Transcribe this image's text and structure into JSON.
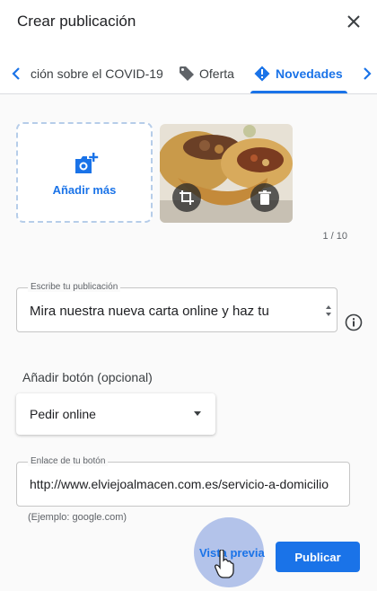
{
  "header": {
    "title": "Crear publicación"
  },
  "tabs": [
    {
      "label": "ción sobre el COVID-19",
      "icon": ""
    },
    {
      "label": "Oferta",
      "icon": "tag-icon"
    },
    {
      "label": "Novedades",
      "icon": "alert-icon",
      "active": true
    }
  ],
  "media": {
    "add_more_label": "Añadir más",
    "counter": "1 / 10"
  },
  "post": {
    "label": "Escribe tu publicación",
    "value": "Mira nuestra nueva carta  online  y haz tu"
  },
  "button_section": {
    "label": "Añadir botón (opcional)",
    "selected": "Pedir online"
  },
  "link": {
    "label": "Enlace de tu botón",
    "value": "http://www.elviejoalmacen.com.es/servicio-a-domicilio",
    "hint": "(Ejemplo: google.com)"
  },
  "actions": {
    "preview_label": "Vista previa",
    "publish_label": "Publicar"
  },
  "colors": {
    "accent": "#1a73e8",
    "text": "#202124",
    "border": "#c6c6c6"
  }
}
